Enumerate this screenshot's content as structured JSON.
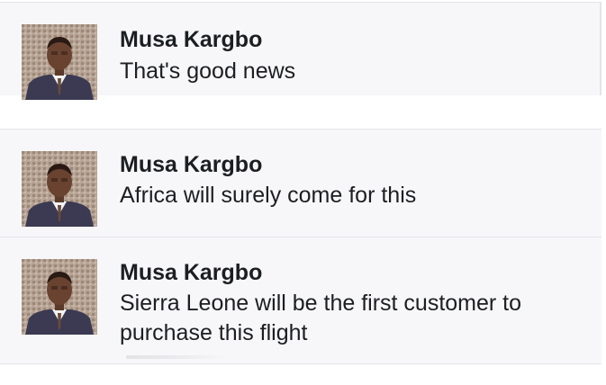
{
  "comments": [
    {
      "author": "Musa Kargbo",
      "text": "That's good news",
      "avatar_icon": "profile-photo"
    },
    {
      "author": "Musa Kargbo",
      "text": "Africa will surely come for this",
      "avatar_icon": "profile-photo"
    },
    {
      "author": "Musa Kargbo",
      "text": "Sierra Leone will be the first customer to purchase this flight",
      "avatar_icon": "profile-photo"
    }
  ],
  "colors": {
    "background": "#ffffff",
    "card": "#f7f7f9",
    "divider": "#e3e4e8",
    "text": "#1c1e21"
  }
}
